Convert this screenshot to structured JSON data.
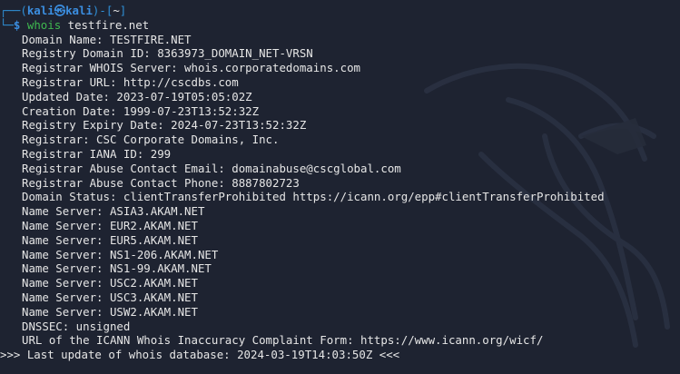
{
  "prompt": {
    "user": "kali",
    "at_symbol": "㉿",
    "host": "kali",
    "cwd": "~",
    "dollar": "$",
    "command": "whois",
    "argument": "testfire.net"
  },
  "output_lines": [
    "Domain Name: TESTFIRE.NET",
    "Registry Domain ID: 8363973_DOMAIN_NET-VRSN",
    "Registrar WHOIS Server: whois.corporatedomains.com",
    "Registrar URL: http://cscdbs.com",
    "Updated Date: 2023-07-19T05:05:02Z",
    "Creation Date: 1999-07-23T13:52:32Z",
    "Registry Expiry Date: 2024-07-23T13:52:32Z",
    "Registrar: CSC Corporate Domains, Inc.",
    "Registrar IANA ID: 299",
    "Registrar Abuse Contact Email: domainabuse@cscglobal.com",
    "Registrar Abuse Contact Phone: 8887802723",
    "Domain Status: clientTransferProhibited https://icann.org/epp#clientTransferProhibited",
    "Name Server: ASIA3.AKAM.NET",
    "Name Server: EUR2.AKAM.NET",
    "Name Server: EUR5.AKAM.NET",
    "Name Server: NS1-206.AKAM.NET",
    "Name Server: NS1-99.AKAM.NET",
    "Name Server: USC2.AKAM.NET",
    "Name Server: USC3.AKAM.NET",
    "Name Server: USW2.AKAM.NET",
    "DNSSEC: unsigned",
    "URL of the ICANN Whois Inaccuracy Complaint Form: https://www.icann.org/wicf/"
  ],
  "last_update_line": ">>> Last update of whois database: 2024-03-19T14:03:50Z <<<",
  "colors": {
    "background": "#1e2331",
    "prompt_blue": "#3b8ee0",
    "command_green": "#3fb950",
    "text": "#e6e6e6"
  },
  "background_icon": "kali-dragon-logo"
}
